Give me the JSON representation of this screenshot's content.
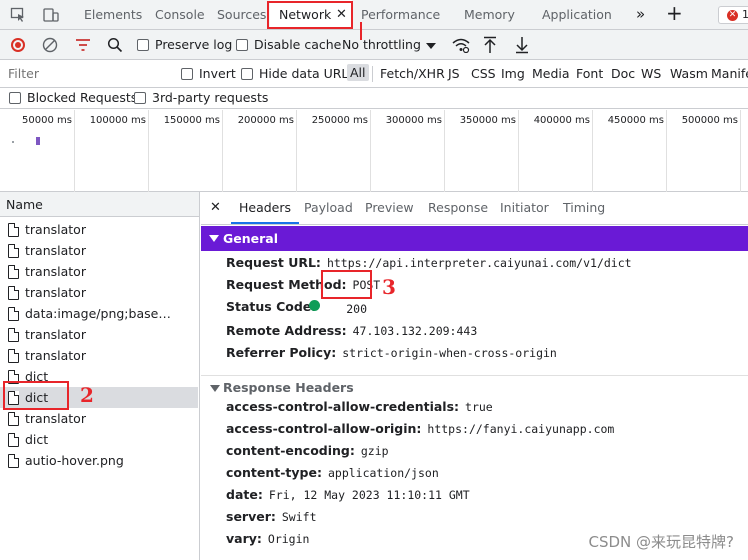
{
  "tabs": [
    {
      "label": "Elements"
    },
    {
      "label": "Console"
    },
    {
      "label": "Sources"
    },
    {
      "label": "Network"
    },
    {
      "label": "Performance"
    },
    {
      "label": "Memory"
    },
    {
      "label": "Application"
    }
  ],
  "error_badge": "1",
  "toolbar": {
    "preserve_log": "Preserve log",
    "disable_cache": "Disable cache",
    "throttling": "No throttling"
  },
  "filterbar": {
    "placeholder": "Filter",
    "invert": "Invert",
    "hide_data_urls": "Hide data URLs",
    "types": [
      "All",
      "Fetch/XHR",
      "JS",
      "CSS",
      "Img",
      "Media",
      "Font",
      "Doc",
      "WS",
      "Wasm",
      "Manife"
    ]
  },
  "blockedbar": {
    "blocked": "Blocked Requests",
    "third_party": "3rd-party requests"
  },
  "timeline": {
    "ticks": [
      "50000 ms",
      "100000 ms",
      "150000 ms",
      "200000 ms",
      "250000 ms",
      "300000 ms",
      "350000 ms",
      "400000 ms",
      "450000 ms",
      "500000 ms"
    ]
  },
  "list": {
    "header": "Name",
    "items": [
      "translator",
      "translator",
      "translator",
      "translator",
      "data:image/png;base…",
      "translator",
      "translator",
      "dict",
      "dict",
      "translator",
      "dict",
      "autio-hover.png"
    ],
    "selected_index": 8
  },
  "detail": {
    "tabs": [
      "Headers",
      "Payload",
      "Preview",
      "Response",
      "Initiator",
      "Timing"
    ],
    "general_title": "General",
    "general": [
      {
        "k": "Request URL:",
        "v": "https://api.interpreter.caiyunai.com/v1/dict"
      },
      {
        "k": "Request Method:",
        "v": "POST"
      },
      {
        "k": "Status Code:",
        "v": "200"
      },
      {
        "k": "Remote Address:",
        "v": "47.103.132.209:443"
      },
      {
        "k": "Referrer Policy:",
        "v": "strict-origin-when-cross-origin"
      }
    ],
    "response_title": "Response Headers",
    "response": [
      {
        "k": "access-control-allow-credentials:",
        "v": "true"
      },
      {
        "k": "access-control-allow-origin:",
        "v": "https://fanyi.caiyunapp.com"
      },
      {
        "k": "content-encoding:",
        "v": "gzip"
      },
      {
        "k": "content-type:",
        "v": "application/json"
      },
      {
        "k": "date:",
        "v": "Fri, 12 May 2023 11:10:11 GMT"
      },
      {
        "k": "server:",
        "v": "Swift"
      },
      {
        "k": "vary:",
        "v": "Origin"
      }
    ]
  },
  "annotations": [
    "1",
    "2",
    "3"
  ],
  "watermark": "CSDN @来玩昆特牌?",
  "colors": {
    "accent": "#1a73e8",
    "general_bg": "#6a1ad6",
    "annotation": "#e8252a",
    "status_ok": "#0f9d58"
  }
}
